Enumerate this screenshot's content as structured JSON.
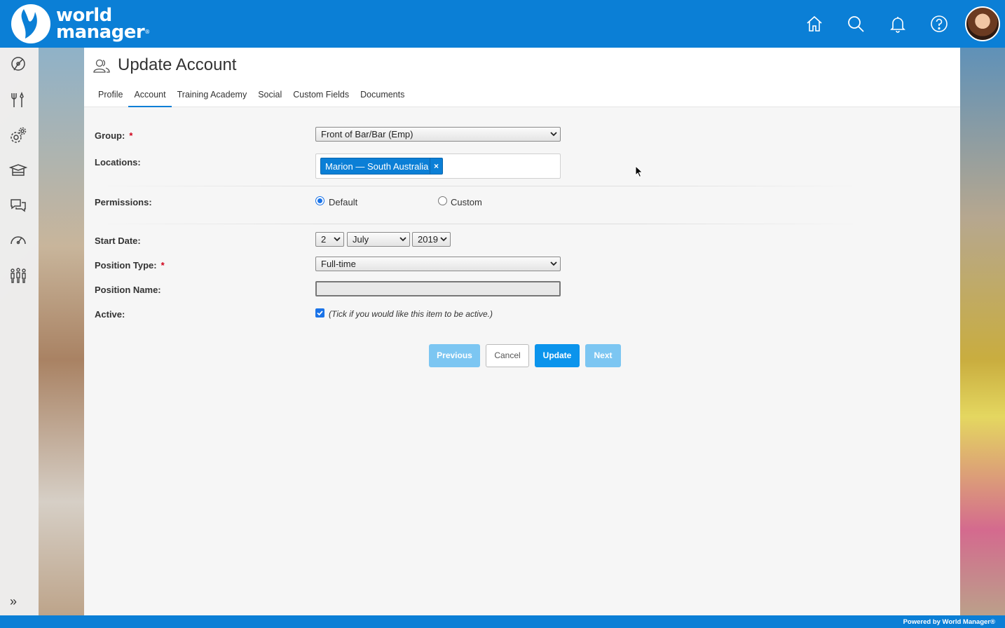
{
  "brand": {
    "line1": "world",
    "line2": "manager",
    "mark": "®",
    "color": "#0b7fd6"
  },
  "topnav": {
    "icons": [
      "home-icon",
      "search-icon",
      "bell-icon",
      "help-icon"
    ]
  },
  "rail": {
    "icons": [
      "dashboard-icon",
      "tools-icon",
      "settings-icon",
      "training-icon",
      "chat-icon",
      "gauge-icon",
      "people-icon"
    ],
    "expand": "»"
  },
  "page": {
    "title": "Update Account",
    "tabs": [
      {
        "label": "Profile",
        "active": false
      },
      {
        "label": "Account",
        "active": true
      },
      {
        "label": "Training Academy",
        "active": false
      },
      {
        "label": "Social",
        "active": false
      },
      {
        "label": "Custom Fields",
        "active": false
      },
      {
        "label": "Documents",
        "active": false
      }
    ]
  },
  "form": {
    "group": {
      "label": "Group:",
      "required": "*",
      "value": "Front of Bar/Bar (Emp)"
    },
    "locations": {
      "label": "Locations:",
      "tag": "Marion — South Australia",
      "remove": "×"
    },
    "permissions": {
      "label": "Permissions:",
      "options": [
        "Default",
        "Custom"
      ],
      "selected": "Default"
    },
    "start_date": {
      "label": "Start Date:",
      "day": "2",
      "month": "July",
      "year": "2019"
    },
    "position_type": {
      "label": "Position Type:",
      "required": "*",
      "value": "Full-time"
    },
    "position_name": {
      "label": "Position Name:",
      "value": ""
    },
    "active": {
      "label": "Active:",
      "checked": true,
      "hint": "(Tick if you would like this item to be active.)"
    }
  },
  "buttons": {
    "previous": "Previous",
    "cancel": "Cancel",
    "update": "Update",
    "next": "Next"
  },
  "footer": {
    "text": "Powered by World Manager®"
  }
}
